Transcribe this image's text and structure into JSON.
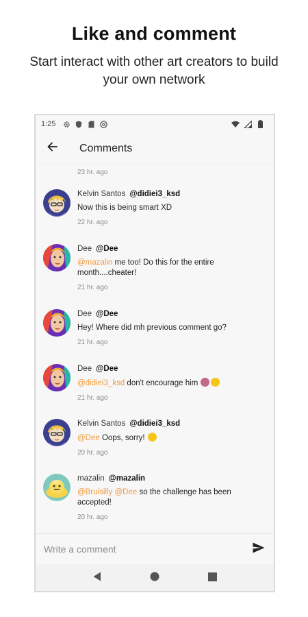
{
  "promo": {
    "title": "Like and comment",
    "subtitle": "Start interact with other art creators to build your own network"
  },
  "status_bar": {
    "time": "1:25",
    "left_icons": [
      "gear-icon",
      "shield-icon",
      "sd-card-icon",
      "at-sign-icon"
    ],
    "right_icons": [
      "wifi-icon",
      "signal-icon",
      "battery-icon"
    ]
  },
  "app_bar": {
    "back_icon": "arrow-left-icon",
    "title": "Comments"
  },
  "feed": {
    "top_time": "23 hr. ago",
    "comments": [
      {
        "author": "Kelvin Santos",
        "handle": "@didiei3_ksd",
        "avatar": "kelvin-avatar",
        "mention": "",
        "text": "Now this is being smart XD",
        "time": "22 hr. ago"
      },
      {
        "author": "Dee",
        "handle": "@Dee",
        "avatar": "dee-avatar",
        "mention": "@mazalin",
        "text": "me too! Do this for the entire month....cheater!",
        "time": "21 hr. ago"
      },
      {
        "author": "Dee",
        "handle": "@Dee",
        "avatar": "dee-avatar",
        "mention": "",
        "text": "Hey! Where did mh previous comment go?",
        "time": "21 hr. ago"
      },
      {
        "author": "Dee",
        "handle": "@Dee",
        "avatar": "dee-avatar",
        "mention": "@didiei3_ksd",
        "text": "don't encourage him",
        "emojis": [
          "woman-gesturing-no-emoji",
          "disappointed-face-emoji"
        ],
        "time": "21 hr. ago"
      },
      {
        "author": "Kelvin Santos",
        "handle": "@didiei3_ksd",
        "avatar": "kelvin-avatar",
        "mention": "@Dee",
        "text": "Oops, sorry!",
        "emojis": [
          "grinning-sweat-emoji"
        ],
        "time": "20 hr. ago"
      },
      {
        "author": "mazalin",
        "handle": "@mazalin",
        "avatar": "mazalin-avatar",
        "mention": "@Bruisilly @Dee",
        "text": "so the challenge has been accepted!",
        "time": "20 hr. ago"
      }
    ]
  },
  "composer": {
    "placeholder": "Write a comment",
    "send_icon": "send-icon"
  },
  "nav_bar": {
    "icons": [
      "back-triangle-icon",
      "home-circle-icon",
      "recents-square-icon"
    ]
  },
  "colors": {
    "mention": "#f39a3d",
    "surface": "#f7f7f7",
    "text": "#222222",
    "muted": "#8a8a8a"
  }
}
